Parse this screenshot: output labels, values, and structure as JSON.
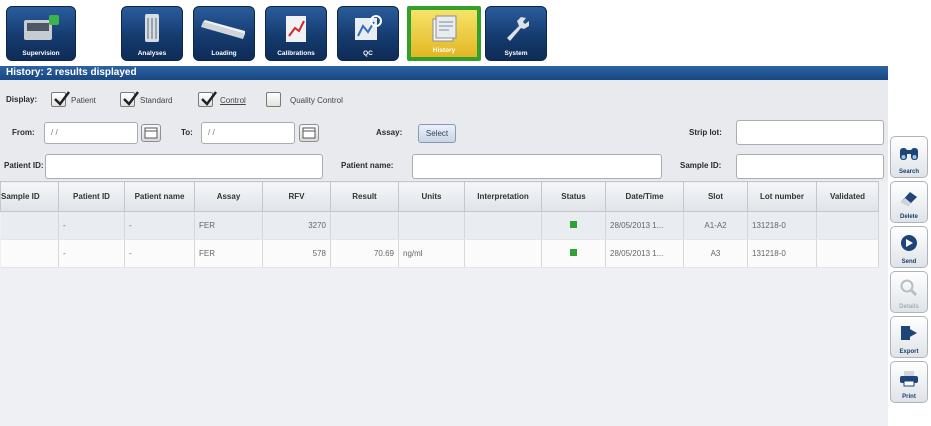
{
  "nav": {
    "items": [
      {
        "label": "Supervision",
        "icon": "supervision-icon"
      },
      {
        "label": "Analyses",
        "icon": "analyses-icon"
      },
      {
        "label": "Loading",
        "icon": "loading-icon"
      },
      {
        "label": "Calibrations",
        "icon": "calibrations-icon"
      },
      {
        "label": "QC",
        "icon": "qc-icon"
      },
      {
        "label": "History",
        "icon": "history-icon",
        "active": true
      },
      {
        "label": "System",
        "icon": "system-icon"
      }
    ]
  },
  "title": "History: 2 results displayed",
  "filters": {
    "display_label": "Display:",
    "checkboxes": [
      {
        "label": "Patient",
        "checked": true
      },
      {
        "label": "Standard",
        "checked": true
      },
      {
        "label": "Control",
        "checked": true
      },
      {
        "label": "Quality Control",
        "checked": false
      }
    ],
    "from_label": "From:",
    "from_value": "/ /",
    "to_label": "To:",
    "to_value": "/ /",
    "assay_label": "Assay:",
    "select_label": "Select",
    "strip_lot_label": "Strip lot:",
    "strip_lot_value": "",
    "patient_id_label": "Patient ID:",
    "patient_id_value": "",
    "patient_name_label": "Patient name:",
    "patient_name_value": "",
    "sample_id_label": "Sample ID:",
    "sample_id_value": ""
  },
  "table": {
    "headers": [
      "Sample ID",
      "Patient ID",
      "Patient name",
      "Assay",
      "RFV",
      "Result",
      "Units",
      "Interpretation",
      "Status",
      "Date/Time",
      "Slot",
      "Lot number",
      "Validated"
    ],
    "rows": [
      [
        "",
        "-",
        "-",
        "FER",
        "3270",
        "",
        "",
        "",
        "",
        "28/05/2013 1...",
        "A1-A2",
        "131218-0",
        ""
      ],
      [
        "",
        "-",
        "-",
        "FER",
        "578",
        "70.69",
        "ng/ml",
        "",
        "",
        "28/05/2013 1...",
        "A3",
        "131218-0",
        ""
      ]
    ],
    "status_color": "#2fa136"
  },
  "sidebar": {
    "items": [
      {
        "label": "Search",
        "icon": "binoculars-icon",
        "enabled": true
      },
      {
        "label": "Delete",
        "icon": "eraser-icon",
        "enabled": true
      },
      {
        "label": "Send",
        "icon": "send-icon",
        "enabled": true
      },
      {
        "label": "Details",
        "icon": "magnifier-icon",
        "enabled": false
      },
      {
        "label": "Export",
        "icon": "export-icon",
        "enabled": true
      },
      {
        "label": "Print",
        "icon": "printer-icon",
        "enabled": true
      }
    ]
  }
}
